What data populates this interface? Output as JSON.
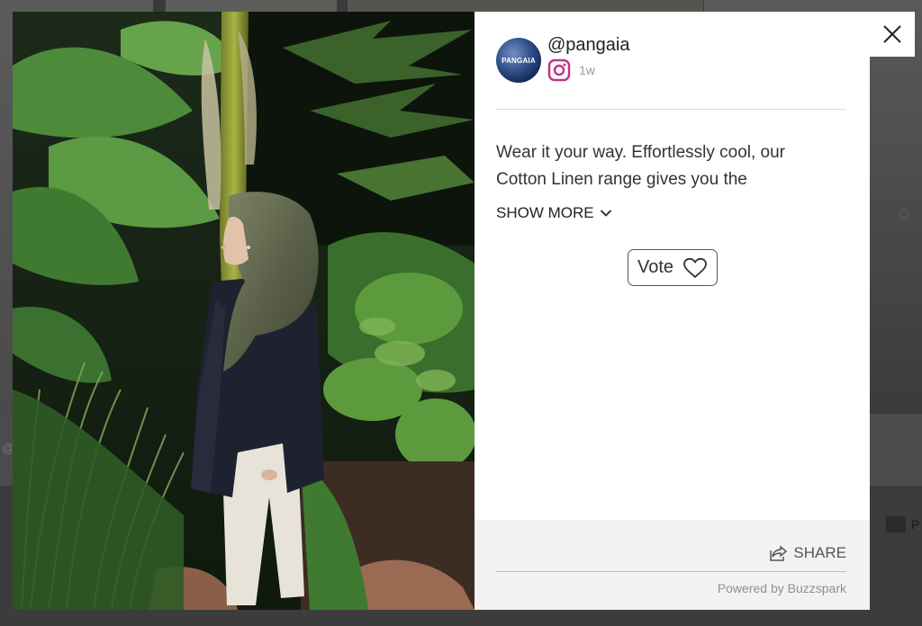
{
  "background": {
    "handle_fragment": "@",
    "right_fragment": "P"
  },
  "post": {
    "image_alt": "Woman in a green satin headscarf and navy shirt standing among tropical plants",
    "avatar_text": "PANGAIA",
    "handle": "@pangaia",
    "platform_icon": "instagram-icon",
    "age": "1w",
    "caption": "Wear it your way. Effortlessly cool, our Cotton Linen range gives you the",
    "show_more_label": "SHOW MORE",
    "vote_label": "Vote"
  },
  "footer": {
    "share_label": "SHARE",
    "powered_by": "Powered by Buzzspark"
  },
  "colors": {
    "instagram": "#c2338a",
    "overlay": "#3a3a3a",
    "panel": "#ffffff",
    "footer": "#f2f2f2"
  }
}
